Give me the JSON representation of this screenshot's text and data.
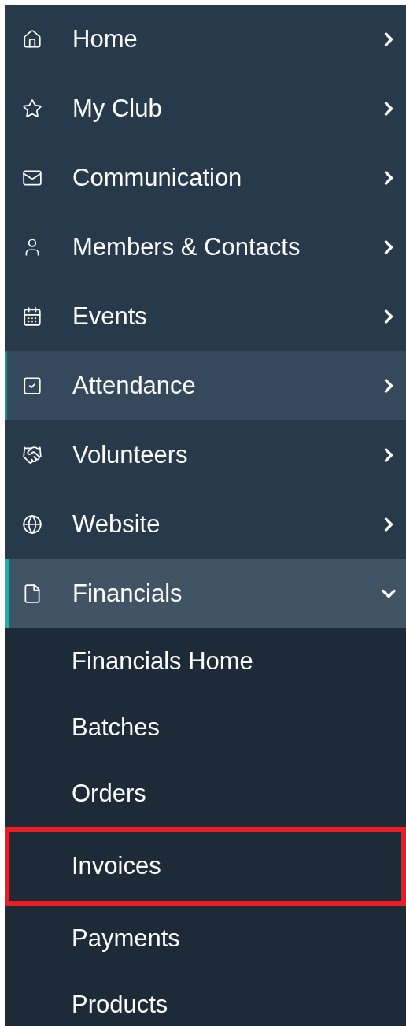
{
  "menu": [
    {
      "label": "Home",
      "expanded": false,
      "hovered": false
    },
    {
      "label": "My Club",
      "expanded": false,
      "hovered": false
    },
    {
      "label": "Communication",
      "expanded": false,
      "hovered": false
    },
    {
      "label": "Members & Contacts",
      "expanded": false,
      "hovered": false
    },
    {
      "label": "Events",
      "expanded": false,
      "hovered": false
    },
    {
      "label": "Attendance",
      "expanded": false,
      "hovered": true
    },
    {
      "label": "Volunteers",
      "expanded": false,
      "hovered": false
    },
    {
      "label": "Website",
      "expanded": false,
      "hovered": false
    },
    {
      "label": "Financials",
      "expanded": true,
      "hovered": false,
      "children": [
        {
          "label": "Financials Home",
          "highlighted": false
        },
        {
          "label": "Batches",
          "highlighted": false
        },
        {
          "label": "Orders",
          "highlighted": false
        },
        {
          "label": "Invoices",
          "highlighted": true
        },
        {
          "label": "Payments",
          "highlighted": false
        },
        {
          "label": "Products",
          "highlighted": false
        }
      ]
    }
  ]
}
